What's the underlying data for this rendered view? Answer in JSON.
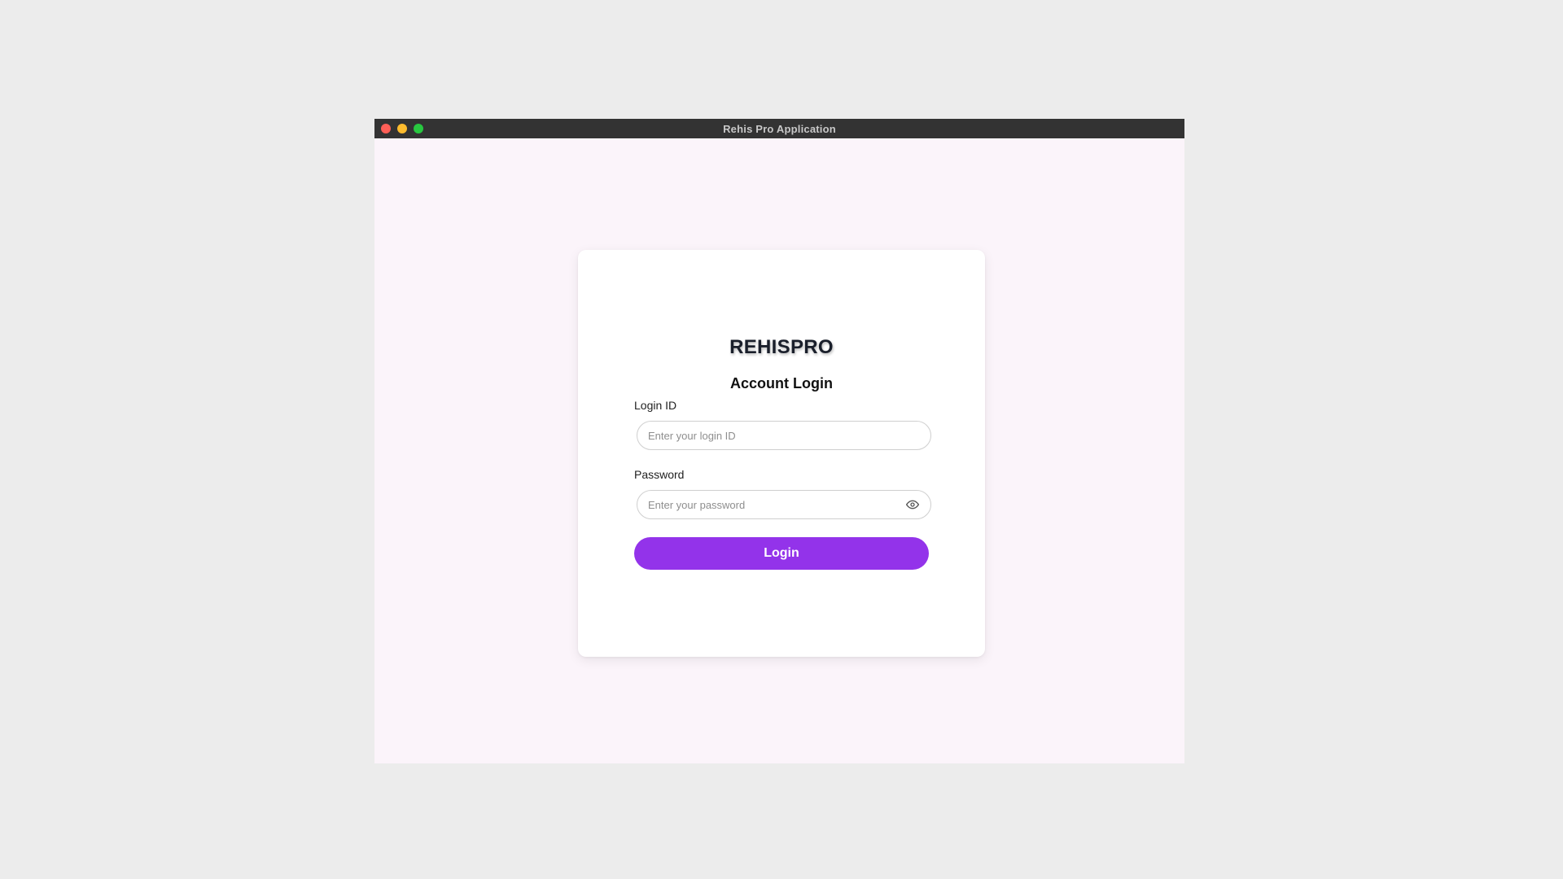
{
  "window": {
    "title": "Rehis Pro Application"
  },
  "login_card": {
    "brand": "REHISPRO",
    "heading": "Account Login",
    "login_id": {
      "label": "Login ID",
      "placeholder": "Enter your login ID",
      "value": ""
    },
    "password": {
      "label": "Password",
      "placeholder": "Enter your password",
      "value": "",
      "toggle_icon": "eye-icon"
    },
    "submit_label": "Login"
  },
  "colors": {
    "accent": "#9333ea",
    "titlebar": "#333333",
    "background": "#fbf4fa"
  }
}
